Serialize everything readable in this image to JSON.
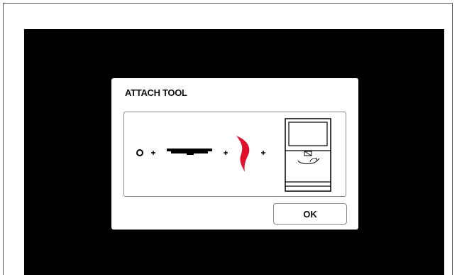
{
  "dialog": {
    "title": "ATTACH TOOL",
    "ok_label": "OK"
  },
  "illustration": {
    "sequence": [
      "ring-icon",
      "plus-icon",
      "tool-bar-icon",
      "plus-icon",
      "blade-icon",
      "plus-icon",
      "machine-icon"
    ],
    "colors": {
      "accent": "#e0102c",
      "ink": "#000000"
    }
  }
}
